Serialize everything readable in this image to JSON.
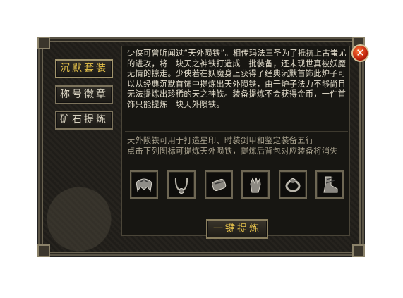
{
  "nav": {
    "items": [
      {
        "label": "沉默套装",
        "active": true
      },
      {
        "label": "称号徽章",
        "active": false
      },
      {
        "label": "矿石提炼",
        "active": false
      }
    ]
  },
  "close": {
    "label": "✕"
  },
  "content": {
    "description": "少侠可曾听闻过“天外陨铁”。相传玛法三圣为了抵抗上古蚩尤的进攻，将一块天之神铁打造成一批装备，还未现世真被妖魔无情的掠走。少侠若在妖魔身上获得了经典沉默首饰此炉子可以从经典沉默首饰中提炼出天外陨铁，由于炉子法力不够尚且无法提炼出珍稀的天之神铁。装备提炼不会获得金币，一件首饰只能提炼一块天外陨铁。",
    "info_line1": "天外陨铁可用于打造星印、时装剑甲和鉴定装备五行",
    "info_line2": "点击下列图标可提炼天外陨铁，提炼后背包对应装备将消失"
  },
  "slots": [
    {
      "icon": "helmet-icon"
    },
    {
      "icon": "necklace-icon"
    },
    {
      "icon": "bracelet-icon"
    },
    {
      "icon": "gauntlet-icon"
    },
    {
      "icon": "ring-icon"
    },
    {
      "icon": "boots-icon"
    }
  ],
  "actions": {
    "refine_all_label": "一键提炼"
  },
  "colors": {
    "accent": "#e7c34a",
    "text": "#e2dccb",
    "muted": "#aaa38f"
  }
}
